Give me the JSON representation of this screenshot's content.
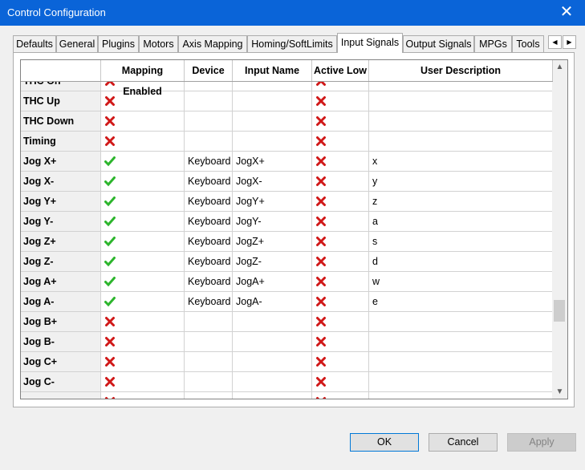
{
  "window": {
    "title": "Control Configuration",
    "close_glyph": "✕"
  },
  "tabs": [
    {
      "label": "Defaults"
    },
    {
      "label": "General"
    },
    {
      "label": "Plugins"
    },
    {
      "label": "Motors"
    },
    {
      "label": "Axis Mapping"
    },
    {
      "label": "Homing/SoftLimits"
    },
    {
      "label": "Input Signals"
    },
    {
      "label": "Output Signals"
    },
    {
      "label": "MPGs"
    },
    {
      "label": "Tools"
    }
  ],
  "active_tab": "Input Signals",
  "tab_scroll": {
    "left": "◀",
    "right": "▶"
  },
  "grid": {
    "columns": [
      "",
      "Mapping Enabled",
      "Device",
      "Input Name",
      "Active Low",
      "User Description"
    ],
    "rows": [
      {
        "name": "THC On",
        "enabled": false,
        "device": "",
        "input": "",
        "active_low": false,
        "desc": ""
      },
      {
        "name": "THC Up",
        "enabled": false,
        "device": "",
        "input": "",
        "active_low": false,
        "desc": ""
      },
      {
        "name": "THC Down",
        "enabled": false,
        "device": "",
        "input": "",
        "active_low": false,
        "desc": ""
      },
      {
        "name": "Timing",
        "enabled": false,
        "device": "",
        "input": "",
        "active_low": false,
        "desc": ""
      },
      {
        "name": "Jog X+",
        "enabled": true,
        "device": "Keyboard",
        "input": "JogX+",
        "active_low": false,
        "desc": "x"
      },
      {
        "name": "Jog X-",
        "enabled": true,
        "device": "Keyboard",
        "input": "JogX-",
        "active_low": false,
        "desc": "y"
      },
      {
        "name": "Jog Y+",
        "enabled": true,
        "device": "Keyboard",
        "input": "JogY+",
        "active_low": false,
        "desc": "z"
      },
      {
        "name": "Jog Y-",
        "enabled": true,
        "device": "Keyboard",
        "input": "JogY-",
        "active_low": false,
        "desc": "a"
      },
      {
        "name": "Jog Z+",
        "enabled": true,
        "device": "Keyboard",
        "input": "JogZ+",
        "active_low": false,
        "desc": "s"
      },
      {
        "name": "Jog Z-",
        "enabled": true,
        "device": "Keyboard",
        "input": "JogZ-",
        "active_low": false,
        "desc": "d"
      },
      {
        "name": "Jog A+",
        "enabled": true,
        "device": "Keyboard",
        "input": "JogA+",
        "active_low": false,
        "desc": "w"
      },
      {
        "name": "Jog A-",
        "enabled": true,
        "device": "Keyboard",
        "input": "JogA-",
        "active_low": false,
        "desc": "e"
      },
      {
        "name": "Jog B+",
        "enabled": false,
        "device": "",
        "input": "",
        "active_low": false,
        "desc": ""
      },
      {
        "name": "Jog B-",
        "enabled": false,
        "device": "",
        "input": "",
        "active_low": false,
        "desc": ""
      },
      {
        "name": "Jog C+",
        "enabled": false,
        "device": "",
        "input": "",
        "active_low": false,
        "desc": ""
      },
      {
        "name": "Jog C-",
        "enabled": false,
        "device": "",
        "input": "",
        "active_low": false,
        "desc": ""
      },
      {
        "name": "",
        "enabled": false,
        "device": "",
        "input": "",
        "active_low": false,
        "desc": ""
      }
    ]
  },
  "scrollbar": {
    "up": "▲",
    "down": "▼",
    "position": 0.78
  },
  "buttons": {
    "ok": "OK",
    "cancel": "Cancel",
    "apply": "Apply"
  },
  "colors": {
    "titlebar": "#0a64d8",
    "check": "#2db52d",
    "cross": "#d01818"
  },
  "icons": {
    "enabled": "green-check-icon",
    "disabled": "red-x-icon"
  }
}
